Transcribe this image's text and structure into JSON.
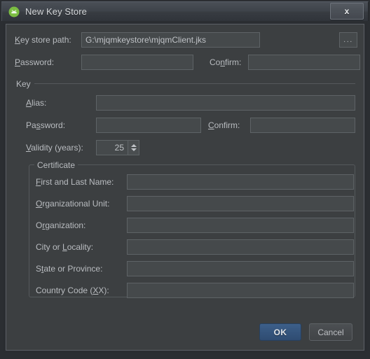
{
  "window": {
    "title": "New Key Store",
    "icon": "android-robot-icon",
    "close_label": "x"
  },
  "keystore": {
    "path_label": "Key store path:",
    "path_label_mnemonic": "K",
    "path_value": "G:\\mjqmkeystore\\mjqmClient.jks",
    "browse_label": "...",
    "password_label": "Password:",
    "password_label_mnemonic": "P",
    "password_value": "",
    "confirm_label": "Confirm:",
    "confirm_label_mnemonic": "n",
    "confirm_value": ""
  },
  "key_group": {
    "title": "Key",
    "alias_label": "Alias:",
    "alias_label_mnemonic": "A",
    "alias_value": "",
    "password_label": "Password:",
    "password_label_mnemonic": "s",
    "password_value": "",
    "confirm_label": "Confirm:",
    "confirm_label_mnemonic": "C",
    "confirm_value": "",
    "validity_label": "Validity (years):",
    "validity_label_mnemonic": "V",
    "validity_value": "25"
  },
  "certificate_group": {
    "title": "Certificate",
    "fields": [
      {
        "label": "First and Last Name:",
        "mnemonic": "F",
        "value": ""
      },
      {
        "label": "Organizational Unit:",
        "mnemonic": "O",
        "value": ""
      },
      {
        "label": "Organization:",
        "mnemonic": "r",
        "value": ""
      },
      {
        "label": "City or Locality:",
        "mnemonic": "L",
        "value": ""
      },
      {
        "label": "State or Province:",
        "mnemonic": "t",
        "value": ""
      },
      {
        "label": "Country Code (XX):",
        "mnemonic": "X",
        "value": ""
      }
    ]
  },
  "buttons": {
    "ok_label": "OK",
    "cancel_label": "Cancel"
  },
  "colors": {
    "dialog_background": "#3c3f41",
    "titlebar_background": "#3e434a",
    "field_background": "#45494b",
    "field_border": "#5e6366",
    "label_text": "#b9bcc0",
    "ok_button_accent": "#35557d",
    "icon_green": "#7bbd42"
  }
}
